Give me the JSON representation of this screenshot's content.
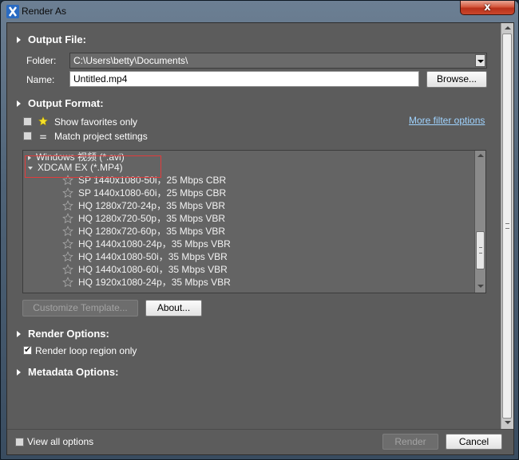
{
  "window": {
    "title": "Render As",
    "close_glyph": "x"
  },
  "output_file": {
    "heading": "Output File:",
    "folder_label": "Folder:",
    "folder_value": "C:\\Users\\betty\\Documents\\",
    "name_label": "Name:",
    "name_value": "Untitled.mp4",
    "browse_label": "Browse..."
  },
  "output_format": {
    "heading": "Output Format:",
    "show_favorites_label": "Show favorites only",
    "match_settings_label": "Match project settings",
    "more_filter_link": "More filter options",
    "tree": {
      "collapsed_item": "Windows 视频 (*.avi)",
      "expanded_item": "XDCAM EX (*.MP4)",
      "templates": [
        "SP 1440x1080-50i，25 Mbps CBR",
        "SP 1440x1080-60i，25 Mbps CBR",
        "HQ 1280x720-24p，35 Mbps VBR",
        "HQ 1280x720-50p，35 Mbps VBR",
        "HQ 1280x720-60p，35 Mbps VBR",
        "HQ 1440x1080-24p，35 Mbps VBR",
        "HQ 1440x1080-50i，35 Mbps VBR",
        "HQ 1440x1080-60i，35 Mbps VBR",
        "HQ 1920x1080-24p，35 Mbps VBR"
      ]
    },
    "customize_label": "Customize Template...",
    "about_label": "About..."
  },
  "render_options": {
    "heading": "Render Options:",
    "loop_region_label": "Render loop region only",
    "loop_region_checked": true
  },
  "metadata_options": {
    "heading": "Metadata Options:"
  },
  "footer": {
    "view_all_label": "View all options",
    "render_label": "Render",
    "cancel_label": "Cancel"
  },
  "icons": [
    "app-icon",
    "close-icon",
    "expand-caret-icon",
    "star-icon",
    "favorite-star-icon",
    "equals-icon",
    "checkmark-icon",
    "dropdown-arrow-icon",
    "scroll-up-icon",
    "scroll-down-icon",
    "scroll-grip-icon"
  ],
  "colors": {
    "link": "#9fd3ff",
    "highlight_box": "#e23b3b",
    "panel": "#5c5c5c"
  }
}
